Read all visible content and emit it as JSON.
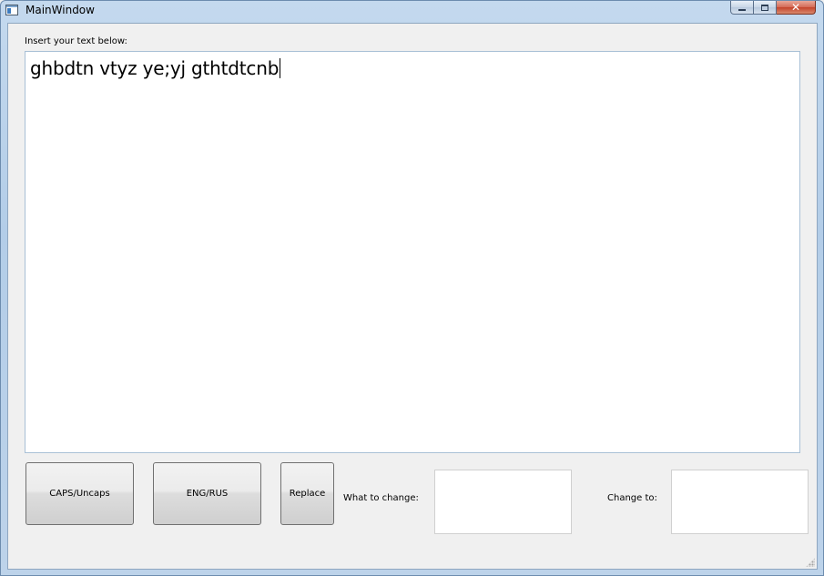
{
  "window": {
    "title": "MainWindow",
    "close_glyph": "✕"
  },
  "editor": {
    "label": "Insert your text below:",
    "text": "ghbdtn vtyz ye;yj gthtdtcnb"
  },
  "buttons": {
    "caps": "CAPS/Uncaps",
    "eng_rus": "ENG/RUS",
    "replace": "Replace"
  },
  "replace": {
    "what_label": "What to change:",
    "what_value": "",
    "to_label": "Change to:",
    "to_value": ""
  },
  "icons": {
    "app": "app-window-icon",
    "minimize": "minimize-icon",
    "maximize": "maximize-icon",
    "close": "close-icon",
    "grip": "size-grip-icon"
  },
  "colors": {
    "titlebar": "#b9d1ea",
    "client_bg": "#f0f0f0",
    "close_button": "#c4432b"
  }
}
